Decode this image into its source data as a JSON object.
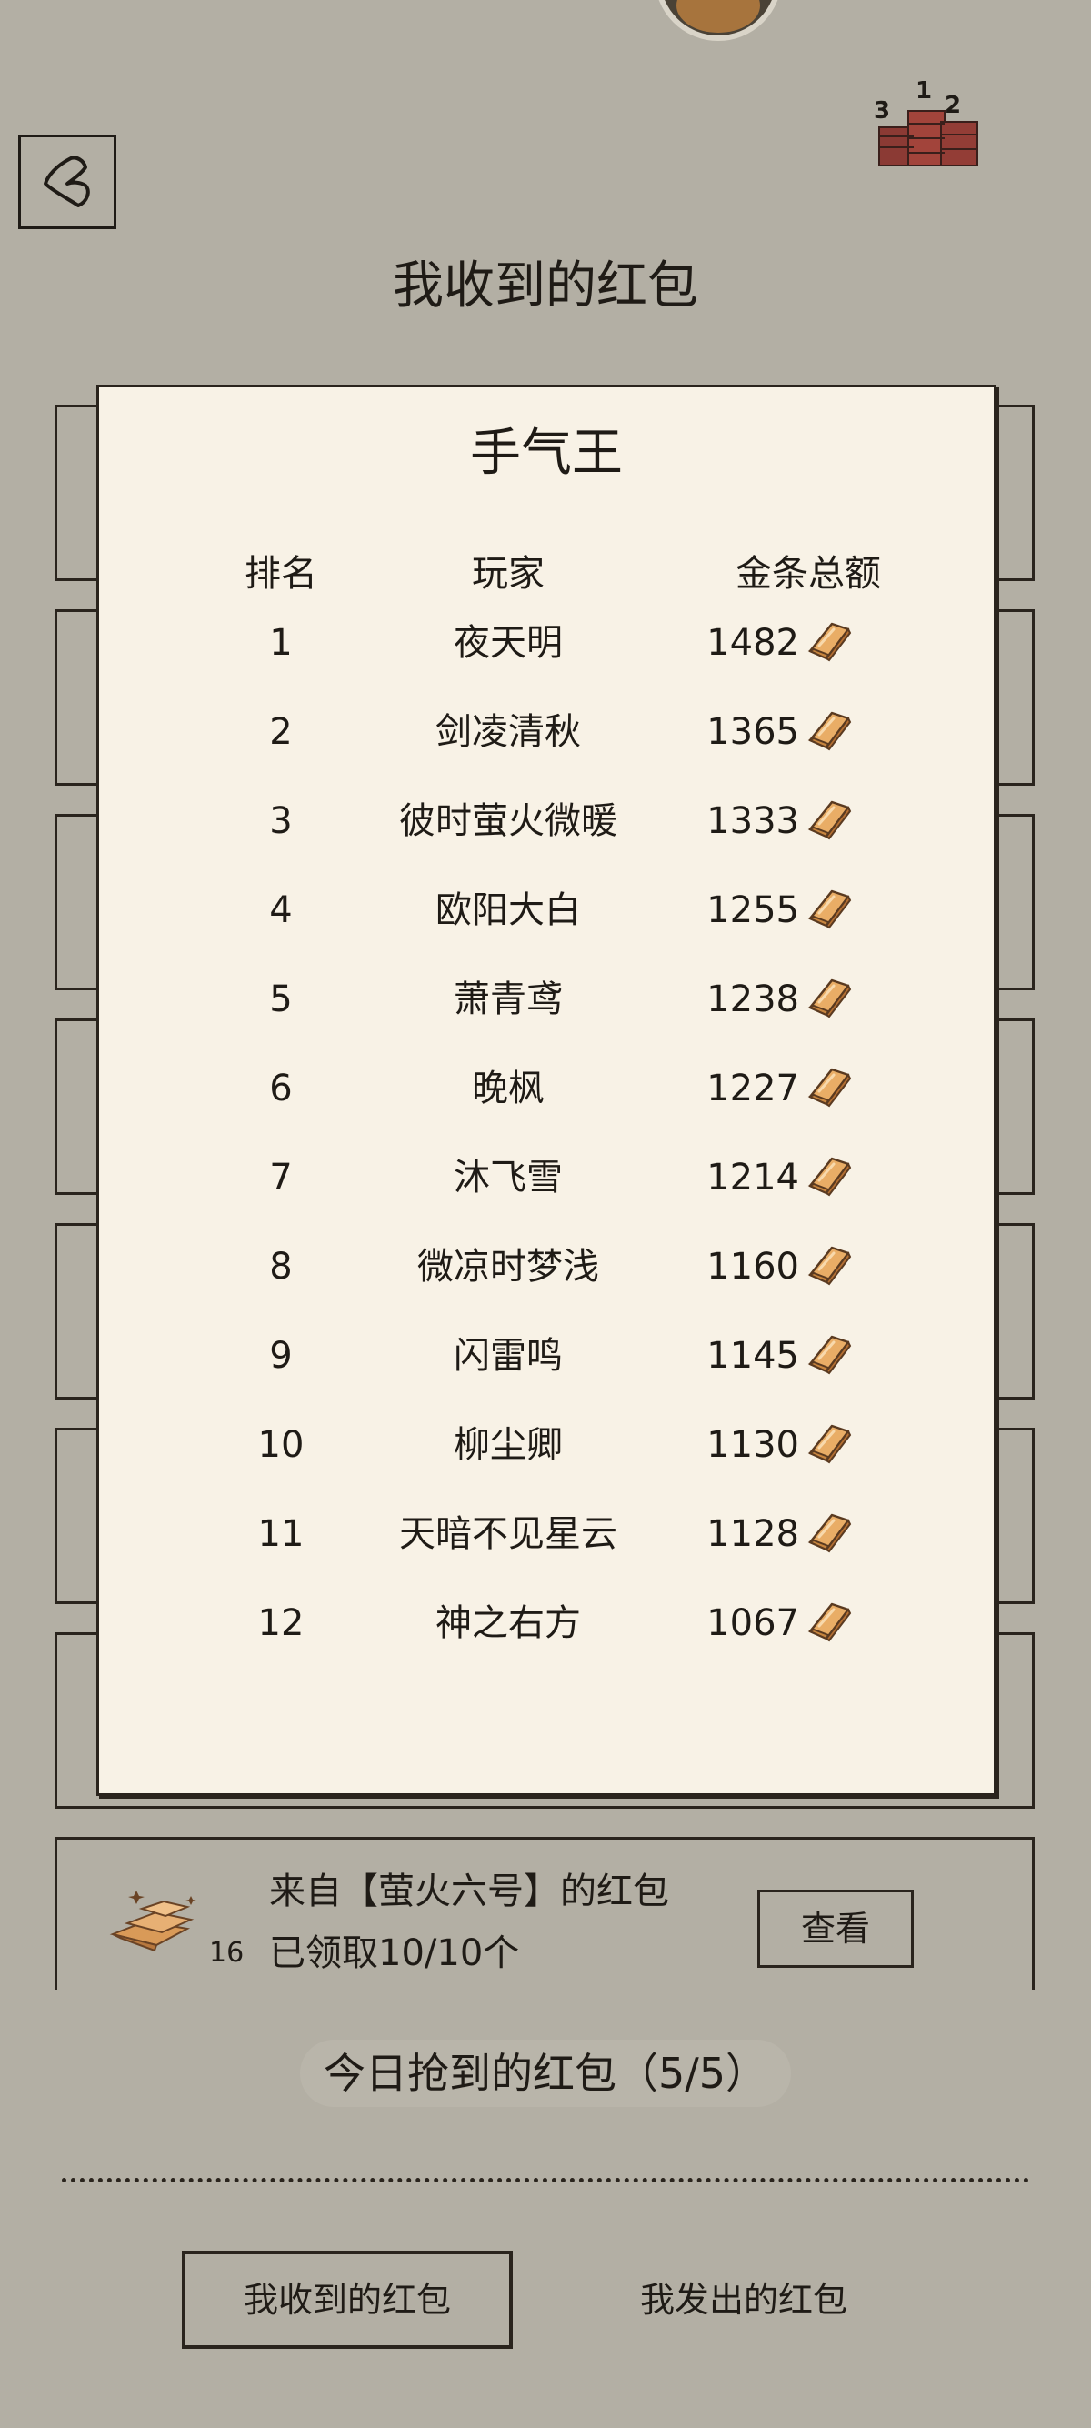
{
  "header": {
    "title": "我收到的红包"
  },
  "leaderboard": {
    "title": "手气王",
    "columns": {
      "rank": "排名",
      "player": "玩家",
      "total": "金条总额"
    },
    "rows": [
      {
        "rank": "1",
        "name": "夜天明",
        "amount": "1482"
      },
      {
        "rank": "2",
        "name": "剑凌清秋",
        "amount": "1365"
      },
      {
        "rank": "3",
        "name": "彼时萤火微暖",
        "amount": "1333"
      },
      {
        "rank": "4",
        "name": "欧阳大白",
        "amount": "1255"
      },
      {
        "rank": "5",
        "name": "萧青鸢",
        "amount": "1238"
      },
      {
        "rank": "6",
        "name": "晚枫",
        "amount": "1227"
      },
      {
        "rank": "7",
        "name": "沐飞雪",
        "amount": "1214"
      },
      {
        "rank": "8",
        "name": "微凉时梦浅",
        "amount": "1160"
      },
      {
        "rank": "9",
        "name": "闪雷鸣",
        "amount": "1145"
      },
      {
        "rank": "10",
        "name": "柳尘卿",
        "amount": "1130"
      },
      {
        "rank": "11",
        "name": "天暗不见星云",
        "amount": "1128"
      },
      {
        "rank": "12",
        "name": "神之右方",
        "amount": "1067"
      }
    ]
  },
  "sender_card": {
    "from": "来自【萤火六号】的红包",
    "claimed": "已领取10/10个",
    "count": "16",
    "view_label": "查看"
  },
  "today": {
    "label": "今日抢到的红包（5/5）"
  },
  "tabs": {
    "received": "我收到的红包",
    "sent": "我发出的红包"
  },
  "icons": {
    "back": "back-arrow-icon",
    "ranking": "ranking-podium-icon",
    "gold": "gold-bar-icon",
    "coins": "gold-pile-icon"
  },
  "colors": {
    "background": "#b3afa4",
    "panel": "#f8f2e6",
    "ink": "#1f1b16",
    "gold": "#e3a25a"
  }
}
